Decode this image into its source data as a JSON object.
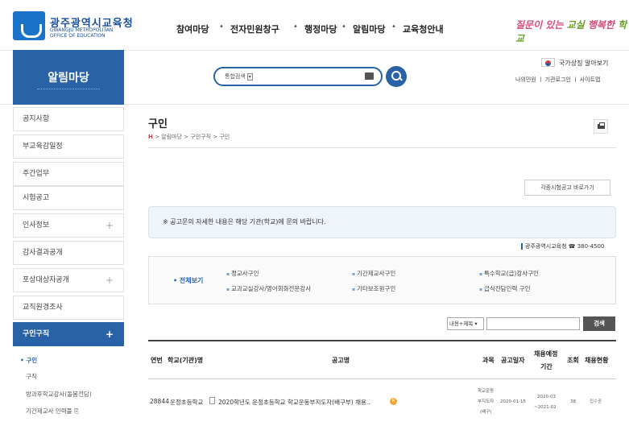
{
  "header": {
    "logo_ko": "광주광역시교육청",
    "logo_en": "GWANGJU METROPOLITAN OFFICE OF EDUCATION",
    "gnb": [
      "참여마당",
      "전자민원창구",
      "행정마당",
      "알림마당",
      "교육청안내"
    ],
    "gnb_separator": "•",
    "slogan_a": "질문이 있는 ",
    "slogan_b": "교실",
    "slogan_c": " 행복한 ",
    "slogan_d": "학교"
  },
  "band": {
    "section_title": "알림마당",
    "search_select": "통합검색",
    "flag_label": "국가상징 알아보기",
    "util_links": "나의민원  ㅣ 기관로그인 ㅣ 사이트맵"
  },
  "sidebar": {
    "items": [
      {
        "label": "공지사항",
        "plus": ""
      },
      {
        "label": "부교육감일정",
        "plus": ""
      },
      {
        "label": "주간업무",
        "plus": ""
      },
      {
        "label": "시험공고",
        "plus": ""
      },
      {
        "label": "인사정보",
        "plus": "+"
      },
      {
        "label": "감사결과공개",
        "plus": ""
      },
      {
        "label": "포상대상자공개",
        "plus": "+"
      },
      {
        "label": "교직원경조사",
        "plus": ""
      },
      {
        "label": "구인구직",
        "plus": "+"
      }
    ],
    "sub": [
      "• 구인",
      "구직",
      "방과후학교강사(돌봄전담)",
      "기간제교사 인력풀 ⎘"
    ]
  },
  "content": {
    "page_title": "구인",
    "breadcrumb_home": "H",
    "breadcrumb": "  >  알림마당  >  구인구직  >  구인",
    "quick_button": "각종시험공고 바로가기",
    "notice": "※ 공고문의 자세한 내용은 해당 기관(학교)에 문의 바랍니다.",
    "contact": "광주광역시교육청 ☎ 380-4500",
    "category_all": "• 전체보기",
    "categories": [
      "정교사구인",
      "기간제교사구인",
      "특수학교(급)강사구인",
      "교과교실강사/영어회화전문강사",
      "기타보조원구인",
      "급식전담인력 구인"
    ],
    "search_select": "내용+제목 ▾",
    "search_button": "검색"
  },
  "table": {
    "headers": {
      "no": "연번",
      "school": "학교(기관)명",
      "title": "공고명",
      "subject": "과목",
      "date": "공고일자",
      "period_line1": "채용예정",
      "period_line2": "기간",
      "views": "조회",
      "status": "채용현황"
    },
    "rows": [
      {
        "no": "28844",
        "school": "운정초등학교",
        "title": "2020학년도 운정초등학교 학교운동부지도자(배구부) 채용..",
        "subject_line1": "학교운동",
        "subject_line2": "부지도자",
        "subject_line3": "(배구)",
        "date": "2020-01-15",
        "period_line1": "2020-03",
        "period_line2": "~2021-02",
        "views": "38",
        "status": "접수중",
        "badge": "N"
      }
    ]
  }
}
